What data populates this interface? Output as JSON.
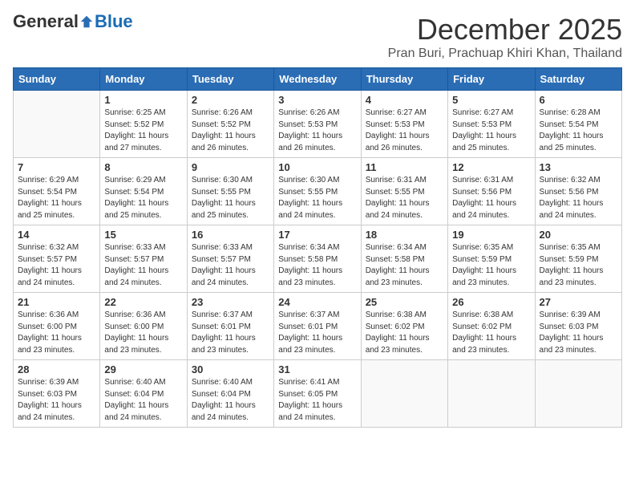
{
  "logo": {
    "general": "General",
    "blue": "Blue"
  },
  "title": "December 2025",
  "location": "Pran Buri, Prachuap Khiri Khan, Thailand",
  "days_of_week": [
    "Sunday",
    "Monday",
    "Tuesday",
    "Wednesday",
    "Thursday",
    "Friday",
    "Saturday"
  ],
  "weeks": [
    [
      {
        "day": "",
        "info": ""
      },
      {
        "day": "1",
        "info": "Sunrise: 6:25 AM\nSunset: 5:52 PM\nDaylight: 11 hours\nand 27 minutes."
      },
      {
        "day": "2",
        "info": "Sunrise: 6:26 AM\nSunset: 5:52 PM\nDaylight: 11 hours\nand 26 minutes."
      },
      {
        "day": "3",
        "info": "Sunrise: 6:26 AM\nSunset: 5:53 PM\nDaylight: 11 hours\nand 26 minutes."
      },
      {
        "day": "4",
        "info": "Sunrise: 6:27 AM\nSunset: 5:53 PM\nDaylight: 11 hours\nand 26 minutes."
      },
      {
        "day": "5",
        "info": "Sunrise: 6:27 AM\nSunset: 5:53 PM\nDaylight: 11 hours\nand 25 minutes."
      },
      {
        "day": "6",
        "info": "Sunrise: 6:28 AM\nSunset: 5:54 PM\nDaylight: 11 hours\nand 25 minutes."
      }
    ],
    [
      {
        "day": "7",
        "info": "Sunrise: 6:29 AM\nSunset: 5:54 PM\nDaylight: 11 hours\nand 25 minutes."
      },
      {
        "day": "8",
        "info": "Sunrise: 6:29 AM\nSunset: 5:54 PM\nDaylight: 11 hours\nand 25 minutes."
      },
      {
        "day": "9",
        "info": "Sunrise: 6:30 AM\nSunset: 5:55 PM\nDaylight: 11 hours\nand 25 minutes."
      },
      {
        "day": "10",
        "info": "Sunrise: 6:30 AM\nSunset: 5:55 PM\nDaylight: 11 hours\nand 24 minutes."
      },
      {
        "day": "11",
        "info": "Sunrise: 6:31 AM\nSunset: 5:55 PM\nDaylight: 11 hours\nand 24 minutes."
      },
      {
        "day": "12",
        "info": "Sunrise: 6:31 AM\nSunset: 5:56 PM\nDaylight: 11 hours\nand 24 minutes."
      },
      {
        "day": "13",
        "info": "Sunrise: 6:32 AM\nSunset: 5:56 PM\nDaylight: 11 hours\nand 24 minutes."
      }
    ],
    [
      {
        "day": "14",
        "info": "Sunrise: 6:32 AM\nSunset: 5:57 PM\nDaylight: 11 hours\nand 24 minutes."
      },
      {
        "day": "15",
        "info": "Sunrise: 6:33 AM\nSunset: 5:57 PM\nDaylight: 11 hours\nand 24 minutes."
      },
      {
        "day": "16",
        "info": "Sunrise: 6:33 AM\nSunset: 5:57 PM\nDaylight: 11 hours\nand 24 minutes."
      },
      {
        "day": "17",
        "info": "Sunrise: 6:34 AM\nSunset: 5:58 PM\nDaylight: 11 hours\nand 23 minutes."
      },
      {
        "day": "18",
        "info": "Sunrise: 6:34 AM\nSunset: 5:58 PM\nDaylight: 11 hours\nand 23 minutes."
      },
      {
        "day": "19",
        "info": "Sunrise: 6:35 AM\nSunset: 5:59 PM\nDaylight: 11 hours\nand 23 minutes."
      },
      {
        "day": "20",
        "info": "Sunrise: 6:35 AM\nSunset: 5:59 PM\nDaylight: 11 hours\nand 23 minutes."
      }
    ],
    [
      {
        "day": "21",
        "info": "Sunrise: 6:36 AM\nSunset: 6:00 PM\nDaylight: 11 hours\nand 23 minutes."
      },
      {
        "day": "22",
        "info": "Sunrise: 6:36 AM\nSunset: 6:00 PM\nDaylight: 11 hours\nand 23 minutes."
      },
      {
        "day": "23",
        "info": "Sunrise: 6:37 AM\nSunset: 6:01 PM\nDaylight: 11 hours\nand 23 minutes."
      },
      {
        "day": "24",
        "info": "Sunrise: 6:37 AM\nSunset: 6:01 PM\nDaylight: 11 hours\nand 23 minutes."
      },
      {
        "day": "25",
        "info": "Sunrise: 6:38 AM\nSunset: 6:02 PM\nDaylight: 11 hours\nand 23 minutes."
      },
      {
        "day": "26",
        "info": "Sunrise: 6:38 AM\nSunset: 6:02 PM\nDaylight: 11 hours\nand 23 minutes."
      },
      {
        "day": "27",
        "info": "Sunrise: 6:39 AM\nSunset: 6:03 PM\nDaylight: 11 hours\nand 23 minutes."
      }
    ],
    [
      {
        "day": "28",
        "info": "Sunrise: 6:39 AM\nSunset: 6:03 PM\nDaylight: 11 hours\nand 24 minutes."
      },
      {
        "day": "29",
        "info": "Sunrise: 6:40 AM\nSunset: 6:04 PM\nDaylight: 11 hours\nand 24 minutes."
      },
      {
        "day": "30",
        "info": "Sunrise: 6:40 AM\nSunset: 6:04 PM\nDaylight: 11 hours\nand 24 minutes."
      },
      {
        "day": "31",
        "info": "Sunrise: 6:41 AM\nSunset: 6:05 PM\nDaylight: 11 hours\nand 24 minutes."
      },
      {
        "day": "",
        "info": ""
      },
      {
        "day": "",
        "info": ""
      },
      {
        "day": "",
        "info": ""
      }
    ]
  ]
}
